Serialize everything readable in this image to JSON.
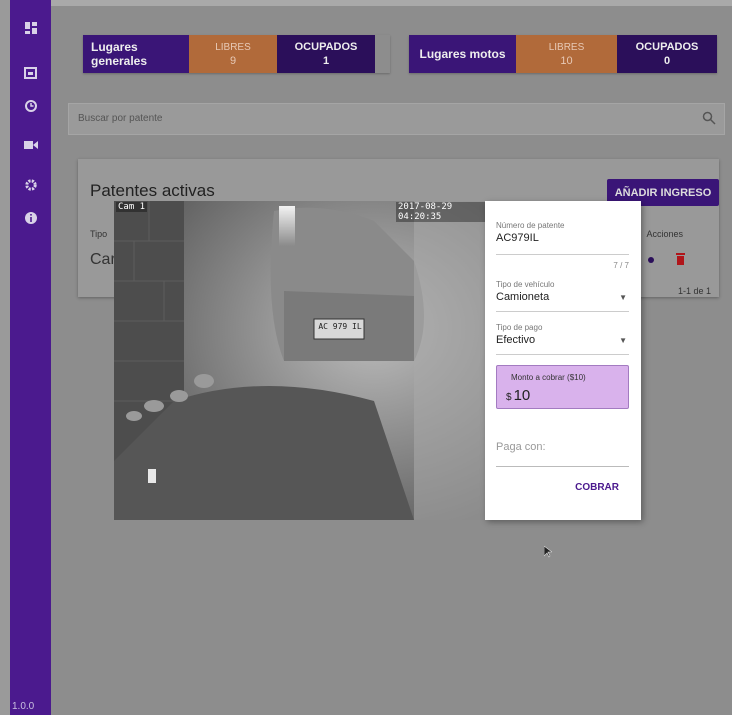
{
  "sidebar": {
    "items": [
      {
        "icon": "dashboard-icon"
      },
      {
        "icon": "calendar-icon"
      },
      {
        "icon": "history-icon"
      },
      {
        "icon": "video-camera-icon"
      },
      {
        "icon": "gear-icon"
      },
      {
        "icon": "info-icon"
      }
    ],
    "version": "1.0.0"
  },
  "stats": {
    "general": {
      "label": "Lugares generales",
      "free_label": "LIBRES",
      "free_value": "9",
      "occupied_label": "OCUPADOS",
      "occupied_value": "1"
    },
    "motos": {
      "label": "Lugares motos",
      "free_label": "LIBRES",
      "free_value": "10",
      "occupied_label": "OCUPADOS",
      "occupied_value": "0"
    }
  },
  "search": {
    "placeholder": "Buscar por patente"
  },
  "active": {
    "title": "Patentes activas",
    "add_button": "AÑADIR INGRESO",
    "columns": {
      "tipo": "Tipo",
      "acciones": "Acciones"
    },
    "row_type": "Car",
    "pagination": "1-1 de 1"
  },
  "camera": {
    "label": "Cam 1",
    "timestamp": "2017-08-29 04:20:35",
    "plate": "AC 979 IL"
  },
  "form": {
    "plate_label": "Número de patente",
    "plate_value": "AC979IL",
    "plate_counter": "7 / 7",
    "vehicle_label": "Tipo de vehículo",
    "vehicle_value": "Camioneta",
    "payment_label": "Tipo de pago",
    "payment_value": "Efectivo",
    "amount_label": "Monto a cobrar ($10)",
    "amount_currency": "$",
    "amount_value": "10",
    "pays_with_label": "Paga con:",
    "submit": "COBRAR"
  },
  "colors": {
    "primary": "#4b1a8e",
    "accent": "#b16a3a",
    "amount_bg": "#d9b2ec"
  }
}
